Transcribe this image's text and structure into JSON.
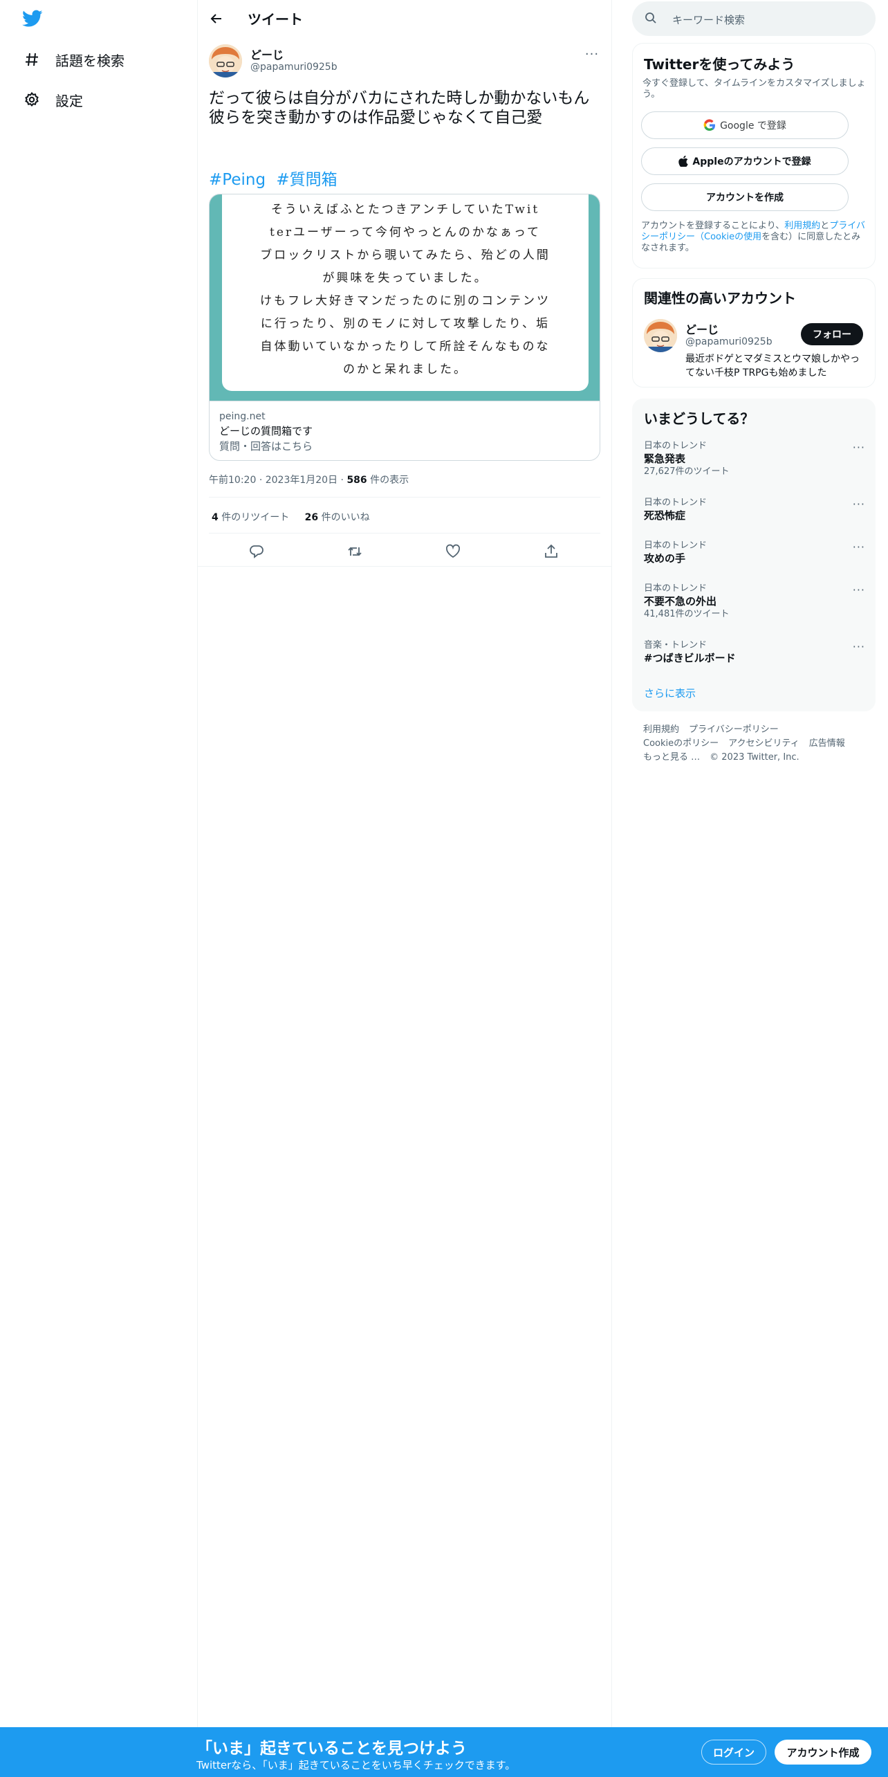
{
  "nav": {
    "explore_label": "話題を検索",
    "settings_label": "設定"
  },
  "header": {
    "title": "ツイート"
  },
  "tweet": {
    "author_name": "どーじ",
    "author_handle": "@papamuri0925b",
    "text": "だって彼らは自分がバカにされた時しか動かないもん\n彼らを突き動かすのは作品愛じゃなくて自己愛",
    "hashtags": [
      "#Peing",
      "#質問箱"
    ],
    "card": {
      "image_text": [
        "そういえばふとたつきアンチしていたTwit",
        "terユーザーって今何やっとんのかなぁって",
        "ブロックリストから覗いてみたら、殆どの人間",
        "が興味を失っていました。",
        "けもフレ大好きマンだったのに別のコンテンツ",
        "に行ったり、別のモノに対して攻撃したり、垢",
        "自体動いていなかったりして所詮そんなものな",
        "のかと呆れました。"
      ],
      "domain": "peing.net",
      "title": "どーじの質問箱です",
      "description": "質問・回答はこちら"
    },
    "time": "午前10:20",
    "date": "2023年1月20日",
    "views_count": "586",
    "views_label": "件の表示",
    "retweets_count": "4",
    "retweets_label": "件のリツイート",
    "likes_count": "26",
    "likes_label": "件のいいね"
  },
  "search": {
    "placeholder": "キーワード検索"
  },
  "signup_box": {
    "title": "Twitterを使ってみよう",
    "subtitle": "今すぐ登録して、タイムラインをカスタマイズしましょう。",
    "google_label": "Google で登録",
    "apple_label": "Appleのアカウントで登録",
    "create_label": "アカウントを作成",
    "legal_1": "アカウントを登録することにより、",
    "legal_terms": "利用規約",
    "legal_2": "と",
    "legal_privacy": "プライバシーポリシー（Cookieの使用",
    "legal_3": "を含む）に同意したとみなされます。"
  },
  "relevant": {
    "title": "関連性の高いアカウント",
    "name": "どーじ",
    "handle": "@papamuri0925b",
    "follow_label": "フォロー",
    "bio": "最近ボドゲとマダミスとウマ娘しかやってない千枝P TRPGも始めました"
  },
  "trends": {
    "title": "いまどうしてる？",
    "items": [
      {
        "context": "日本のトレンド",
        "name": "緊急発表",
        "count": "27,627件のツイート"
      },
      {
        "context": "日本のトレンド",
        "name": "死恐怖症",
        "count": ""
      },
      {
        "context": "日本のトレンド",
        "name": "攻めの手",
        "count": ""
      },
      {
        "context": "日本のトレンド",
        "name": "不要不急の外出",
        "count": "41,481件のツイート"
      },
      {
        "context": "音楽・トレンド",
        "name": "#つばきビルボード",
        "count": ""
      }
    ],
    "show_more": "さらに表示"
  },
  "footer": {
    "links": [
      "利用規約",
      "プライバシーポリシー",
      "Cookieのポリシー",
      "アクセシビリティ",
      "広告情報",
      "もっと見る …"
    ],
    "copyright": "© 2023 Twitter, Inc."
  },
  "banner": {
    "title": "「いま」起きていることを見つけよう",
    "subtitle": "Twitterなら、「いま」起きていることをいち早くチェックできます。",
    "login_label": "ログイン",
    "signup_label": "アカウント作成"
  },
  "colors": {
    "accent": "#1d9bf0",
    "card_frame": "#62b8b5",
    "text": "#0f1419",
    "secondary": "#536471"
  }
}
